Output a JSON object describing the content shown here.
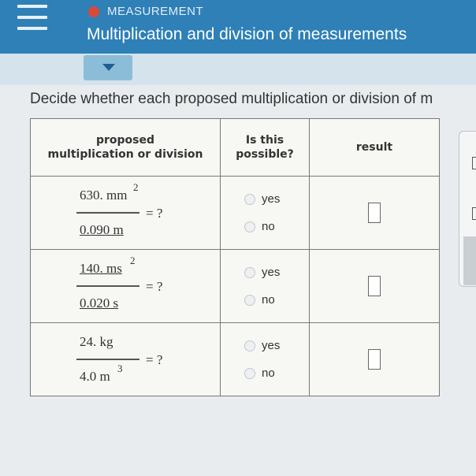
{
  "header": {
    "topic": "MEASUREMENT",
    "title": "Multiplication and division of measurements",
    "accent_color": "#2e80b7",
    "topic_dot_color": "#d84a3a"
  },
  "instruction": "Decide whether each proposed multiplication or division of m",
  "table": {
    "headers": {
      "col1_line1": "proposed",
      "col1_line2": "multiplication or division",
      "col2_line1": "Is this",
      "col2_line2": "possible?",
      "col3": "result"
    },
    "rows": [
      {
        "numerator": "630. mm",
        "num_exp": "2",
        "denominator": "0.090 m",
        "den_exp": "",
        "equals": "= ?",
        "yes": "yes",
        "no": "no"
      },
      {
        "numerator": "140. ms",
        "num_exp": "2",
        "denominator": "0.020 s",
        "den_exp": "",
        "equals": "= ?",
        "yes": "yes",
        "no": "no"
      },
      {
        "numerator": "24. kg",
        "num_exp": "",
        "denominator": "4.0 m",
        "den_exp": "3",
        "equals": "= ?",
        "yes": "yes",
        "no": "no"
      }
    ]
  }
}
